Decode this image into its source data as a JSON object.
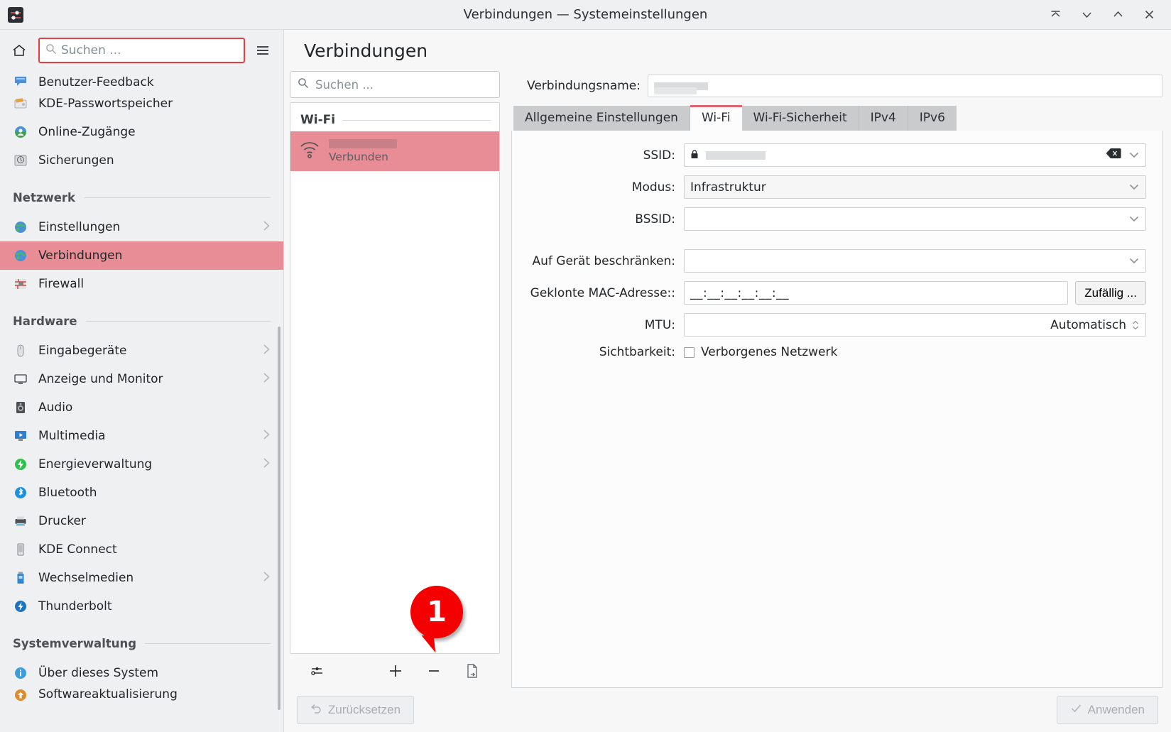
{
  "window": {
    "title": "Verbindungen — Systemeinstellungen",
    "app_icon": "settings-sliders-icon",
    "controls": [
      {
        "name": "keep-above",
        "glyph": "keep-above-icon"
      },
      {
        "name": "minimize",
        "glyph": "chevron-down-icon"
      },
      {
        "name": "maximize",
        "glyph": "chevron-up-icon"
      },
      {
        "name": "close",
        "glyph": "close-icon"
      }
    ]
  },
  "sidebar": {
    "home_icon": "home-icon",
    "menu_icon": "hamburger-icon",
    "search": {
      "placeholder": "Suchen ...",
      "value": "",
      "icon": "search-icon",
      "focused": true,
      "focus_color": "#e63c3c"
    },
    "items": [
      {
        "label": "Benutzer-Feedback",
        "icon": "feedback-icon",
        "has_chevron": false,
        "selected": false,
        "clipped": true
      },
      {
        "label": "KDE-Passwortspeicher",
        "icon": "wallet-icon",
        "has_chevron": false,
        "selected": false
      },
      {
        "label": "Online-Zugänge",
        "icon": "online-accounts-icon",
        "has_chevron": false,
        "selected": false
      },
      {
        "label": "Sicherungen",
        "icon": "backup-icon",
        "has_chevron": false,
        "selected": false
      }
    ],
    "group_netzwerk": {
      "title": "Netzwerk",
      "items": [
        {
          "label": "Einstellungen",
          "icon": "globe-icon",
          "has_chevron": true,
          "selected": false
        },
        {
          "label": "Verbindungen",
          "icon": "globe-icon",
          "has_chevron": false,
          "selected": true
        },
        {
          "label": "Firewall",
          "icon": "firewall-icon",
          "has_chevron": false,
          "selected": false
        }
      ]
    },
    "group_hardware": {
      "title": "Hardware",
      "items": [
        {
          "label": "Eingabegeräte",
          "icon": "mouse-icon",
          "has_chevron": true,
          "selected": false
        },
        {
          "label": "Anzeige und Monitor",
          "icon": "monitor-icon",
          "has_chevron": true,
          "selected": false
        },
        {
          "label": "Audio",
          "icon": "speaker-icon",
          "has_chevron": false,
          "selected": false
        },
        {
          "label": "Multimedia",
          "icon": "multimedia-icon",
          "has_chevron": true,
          "selected": false
        },
        {
          "label": "Energieverwaltung",
          "icon": "power-icon",
          "has_chevron": true,
          "selected": false
        },
        {
          "label": "Bluetooth",
          "icon": "bluetooth-icon",
          "has_chevron": false,
          "selected": false
        },
        {
          "label": "Drucker",
          "icon": "printer-icon",
          "has_chevron": false,
          "selected": false
        },
        {
          "label": "KDE Connect",
          "icon": "phone-icon",
          "has_chevron": false,
          "selected": false
        },
        {
          "label": "Wechselmedien",
          "icon": "usb-icon",
          "has_chevron": true,
          "selected": false
        },
        {
          "label": "Thunderbolt",
          "icon": "thunderbolt-icon",
          "has_chevron": false,
          "selected": false
        }
      ]
    },
    "group_system": {
      "title": "Systemverwaltung",
      "items": [
        {
          "label": "Über dieses System",
          "icon": "info-icon",
          "has_chevron": false,
          "selected": false
        },
        {
          "label": "Softwareaktualisierung",
          "icon": "update-icon",
          "has_chevron": false,
          "selected": false,
          "clipped": true
        }
      ]
    },
    "selection_color": "#e88d95"
  },
  "content": {
    "page_title": "Verbindungen",
    "list": {
      "search": {
        "placeholder": "Suchen ...",
        "value": "",
        "icon": "search-icon"
      },
      "group_label": "Wi-Fi",
      "items": [
        {
          "name_redacted": true,
          "status": "Verbunden",
          "icon": "wifi-icon",
          "selected": true
        }
      ],
      "toolbar": [
        {
          "name": "configure-button",
          "icon": "sliders-icon",
          "label": ""
        },
        {
          "name": "add-connection-button",
          "icon": "plus-icon",
          "label": "+"
        },
        {
          "name": "remove-connection-button",
          "icon": "minus-icon",
          "label": "−"
        },
        {
          "name": "export-connection-button",
          "icon": "export-document-icon",
          "label": ""
        }
      ]
    },
    "form": {
      "connection_name_label": "Verbindungsname:",
      "connection_name_value": "",
      "tabs": [
        {
          "label": "Allgemeine Einstellungen",
          "active": false
        },
        {
          "label": "Wi-Fi",
          "active": true
        },
        {
          "label": "Wi-Fi-Sicherheit",
          "active": false
        },
        {
          "label": "IPv4",
          "active": false
        },
        {
          "label": "IPv6",
          "active": false
        }
      ],
      "fields": {
        "ssid": {
          "label": "SSID:",
          "value": "",
          "redacted": true,
          "lock_icon": "lock-icon",
          "clear_icon": "clear-backspace-icon",
          "dropdown_icon": "chevron-down-icon"
        },
        "modus": {
          "label": "Modus:",
          "value": "Infrastruktur",
          "dropdown_icon": "chevron-down-icon"
        },
        "bssid": {
          "label": "BSSID:",
          "value": "",
          "dropdown_icon": "chevron-down-icon"
        },
        "restrict_device": {
          "label": "Auf Gerät beschränken:",
          "value": "",
          "dropdown_icon": "chevron-down-icon"
        },
        "cloned_mac": {
          "label": "Geklonte MAC-Adresse::",
          "value": "__:__:__:__:__:__",
          "button_label": "Zufällig ..."
        },
        "mtu": {
          "label": "MTU:",
          "value": "Automatisch",
          "spinner_icon": "spinner-arrows-icon"
        },
        "visibility": {
          "label": "Sichtbarkeit:",
          "checkbox_label": "Verborgenes Netzwerk",
          "checked": false
        }
      }
    },
    "footer": {
      "reset_label": "Zurücksetzen",
      "reset_icon": "undo-icon",
      "reset_disabled": true,
      "apply_label": "Anwenden",
      "apply_icon": "check-icon",
      "apply_disabled": true
    }
  },
  "annotations": [
    {
      "number": "1",
      "color": "#f40000",
      "points_to": "add-connection-button"
    }
  ]
}
